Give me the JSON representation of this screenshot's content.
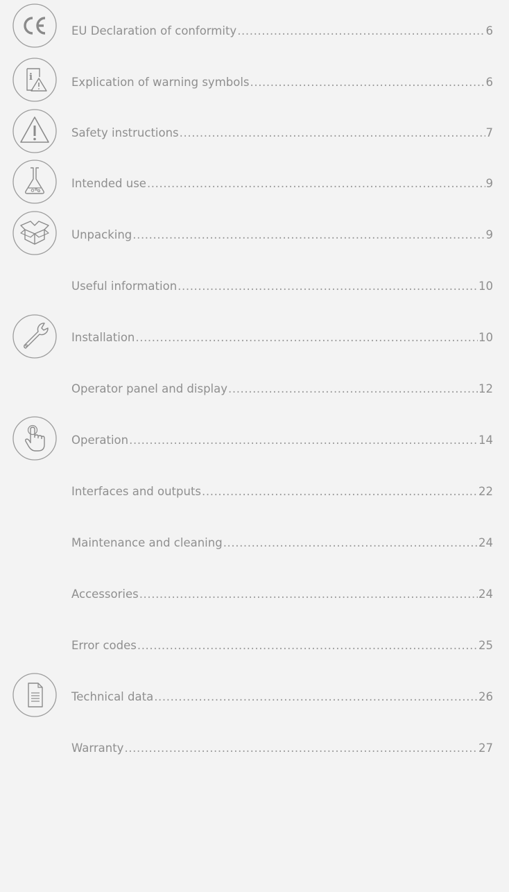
{
  "toc": {
    "entries": [
      {
        "title": "EU Declaration of conformity",
        "page": "6",
        "icon": "ce-mark-icon"
      },
      {
        "title": "Explication of warning symbols",
        "page": "6",
        "icon": "info-warning-icon"
      },
      {
        "title": "Safety instructions",
        "page": "7",
        "icon": "warning-triangle-icon"
      },
      {
        "title": "Intended use",
        "page": "9",
        "icon": "lab-flask-icon"
      },
      {
        "title": "Unpacking",
        "page": "9",
        "icon": "open-box-icon"
      },
      {
        "title": "Useful information",
        "page": "10",
        "icon": ""
      },
      {
        "title": "Installation",
        "page": "10",
        "icon": "wrench-icon"
      },
      {
        "title": "Operator panel and display",
        "page": "12",
        "icon": ""
      },
      {
        "title": "Operation",
        "page": "14",
        "icon": "finger-press-icon"
      },
      {
        "title": "Interfaces and outputs",
        "page": "22",
        "icon": ""
      },
      {
        "title": "Maintenance and cleaning",
        "page": "24",
        "icon": ""
      },
      {
        "title": "Accessories",
        "page": "24",
        "icon": ""
      },
      {
        "title": "Error codes",
        "page": "25",
        "icon": ""
      },
      {
        "title": "Technical data",
        "page": "26",
        "icon": "document-icon"
      },
      {
        "title": "Warranty",
        "page": "27",
        "icon": ""
      }
    ]
  }
}
